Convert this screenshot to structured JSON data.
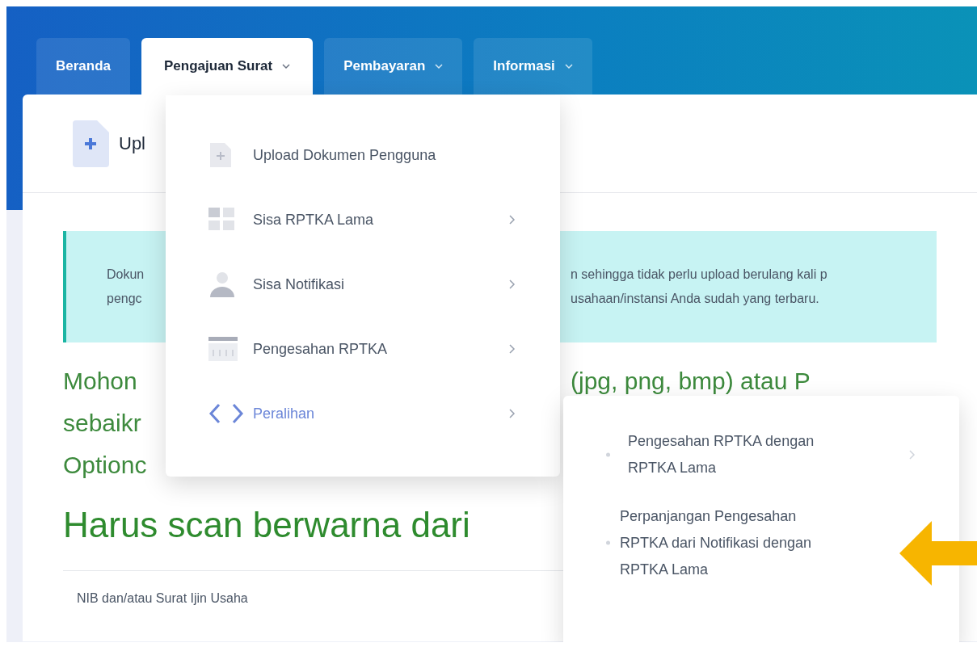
{
  "tabs": [
    {
      "label": "Beranda",
      "selected": false,
      "has_dropdown": false
    },
    {
      "label": "Pengajuan Surat",
      "selected": true,
      "has_dropdown": true
    },
    {
      "label": "Pembayaran",
      "selected": false,
      "has_dropdown": true
    },
    {
      "label": "Informasi",
      "selected": false,
      "has_dropdown": true
    }
  ],
  "card": {
    "title": "Upl",
    "alert": {
      "left_lines": [
        "Dokun",
        "pengc"
      ],
      "right_lines": [
        "n sehingga tidak perlu upload berulang kali p",
        "usahaan/instansi Anda sudah yang terbaru."
      ]
    },
    "notes_left": [
      "Mohon",
      "sebaikr",
      "Optionc"
    ],
    "notes_right": "(jpg, png, bmp) atau P",
    "heading": "Harus scan berwarna dari",
    "document_row": "NIB dan/atau Surat Ijin Usaha"
  },
  "dropdown": {
    "items": [
      {
        "label": "Upload Dokumen Pengguna",
        "kind": "file",
        "has_submenu": false,
        "selected": false
      },
      {
        "label": "Sisa RPTKA Lama",
        "kind": "grid",
        "has_submenu": true,
        "selected": false
      },
      {
        "label": "Sisa Notifikasi",
        "kind": "person",
        "has_submenu": true,
        "selected": false
      },
      {
        "label": "Pengesahan RPTKA",
        "kind": "calendar",
        "has_submenu": true,
        "selected": false
      },
      {
        "label": "Peralihan",
        "kind": "code",
        "has_submenu": true,
        "selected": true
      }
    ]
  },
  "submenu": {
    "items": [
      {
        "label": "Pengesahan RPTKA dengan RPTKA Lama",
        "has_submenu": true
      },
      {
        "label": "Perpanjangan Pengesahan RPTKA dari Notifikasi dengan RPTKA Lama",
        "has_submenu": false
      }
    ]
  }
}
